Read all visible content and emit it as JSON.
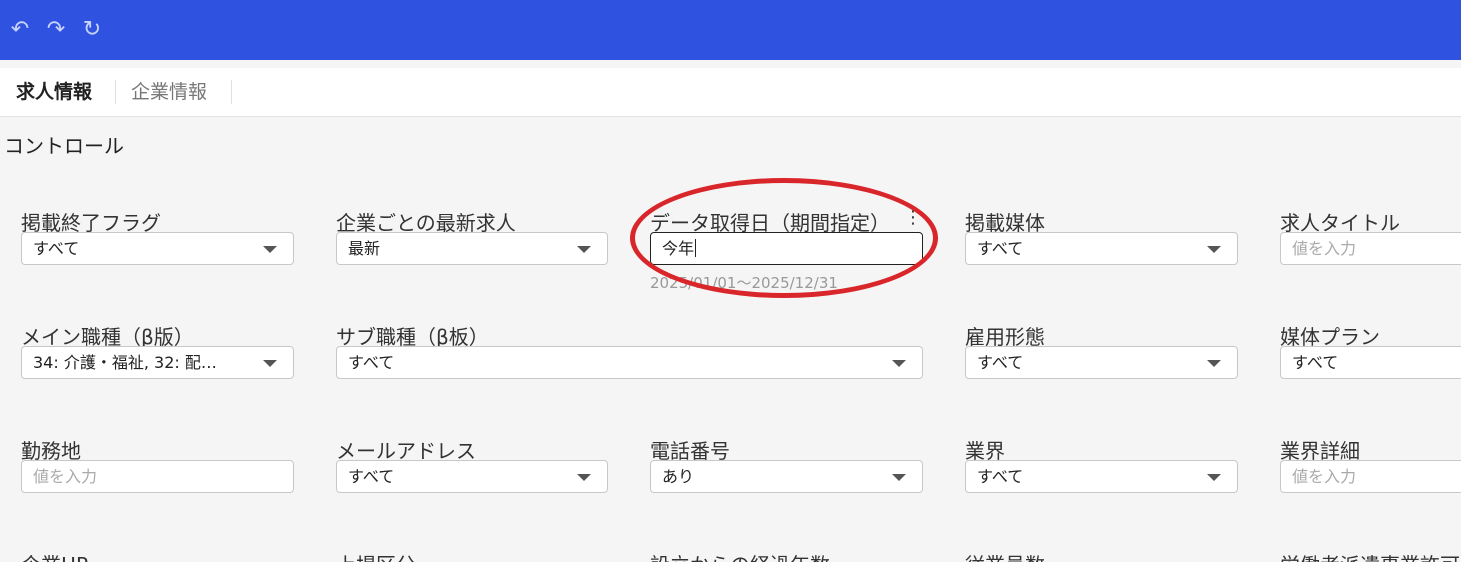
{
  "toolbar": {
    "undo_icon": "undo-icon",
    "redo_icon": "redo-icon",
    "refresh_icon": "refresh-icon",
    "undo_glyph": "↶",
    "redo_glyph": "↷",
    "refresh_glyph": "↻"
  },
  "tabs": [
    {
      "label": "求人情報",
      "active": true
    },
    {
      "label": "企業情報",
      "active": false
    }
  ],
  "section_title": "コントロール",
  "fields": {
    "listing_end_flag": {
      "label": "掲載終了フラグ",
      "value": "すべて"
    },
    "latest_per_company": {
      "label": "企業ごとの最新求人",
      "value": "最新"
    },
    "data_date": {
      "label": "データ取得日（期間指定）",
      "value": "今年",
      "range": "2025/01/01～2025/12/31",
      "menu_glyph": "⋮"
    },
    "media": {
      "label": "掲載媒体",
      "value": "すべて"
    },
    "job_title": {
      "label": "求人タイトル",
      "placeholder": "値を入力"
    },
    "main_job_type": {
      "label": "メイン職種（β版）",
      "value": "34: 介護・福祉, 32: 配…"
    },
    "sub_job_type": {
      "label": "サブ職種（β板）",
      "value": "すべて"
    },
    "employment_type": {
      "label": "雇用形態",
      "value": "すべて"
    },
    "media_plan": {
      "label": "媒体プラン",
      "value": "すべて"
    },
    "work_location": {
      "label": "勤務地",
      "placeholder": "値を入力"
    },
    "email": {
      "label": "メールアドレス",
      "value": "すべて"
    },
    "phone": {
      "label": "電話番号",
      "value": "あり"
    },
    "industry": {
      "label": "業界",
      "value": "すべて"
    },
    "industry_detail": {
      "label": "業界詳細",
      "placeholder": "値を入力"
    },
    "company_hp": {
      "label": "企業HP"
    },
    "listing_category": {
      "label": "上場区分"
    },
    "years_since_founded": {
      "label": "設立からの経過年数"
    },
    "employee_count": {
      "label": "従業員数"
    },
    "dispatch_license": {
      "label": "労働者派遣事業許可"
    }
  },
  "annotation": {
    "color": "#d9262b"
  },
  "colors": {
    "topbar": "#2f52e0",
    "background": "#f5f5f5"
  }
}
